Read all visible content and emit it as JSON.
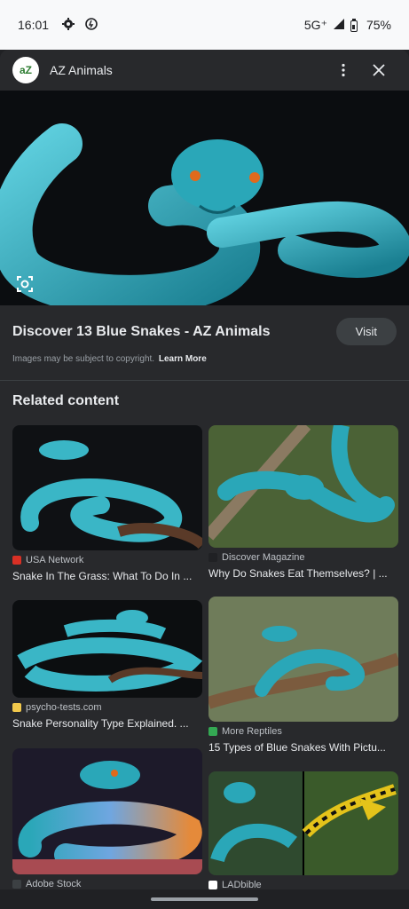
{
  "status_bar": {
    "time": "16:01",
    "network": "5G⁺",
    "battery_percent": "75%",
    "battery_level": 0.75
  },
  "header": {
    "site_name": "AZ Animals",
    "logo_text": "aZ",
    "more_icon": "more-vert-icon",
    "close_icon": "close-icon"
  },
  "preview": {
    "title": "Discover 13 Blue Snakes - AZ Animals",
    "visit_label": "Visit",
    "copyright_text": "Images may be subject to copyright.",
    "learn_more": "Learn More",
    "lens_icon": "lens-icon"
  },
  "related": {
    "heading": "Related content",
    "items": [
      {
        "source": "USA Network",
        "caption": "Snake In The Grass: What To Do In ...",
        "favicon_color": "#d93025"
      },
      {
        "source": "Discover Magazine",
        "caption": "Why Do Snakes Eat Themselves? | ...",
        "favicon_color": "#202124"
      },
      {
        "source": "psycho-tests.com",
        "caption": "Snake Personality Type Explained. ...",
        "favicon_color": "#f2c94c"
      },
      {
        "source": "More Reptiles",
        "caption": "15 Types of Blue Snakes With Pictu...",
        "favicon_color": "#34a853"
      },
      {
        "source": "Adobe Stock",
        "caption": "",
        "favicon_color": "#3c4043"
      },
      {
        "source": "LADbible",
        "caption": "",
        "favicon_color": "#ffffff"
      }
    ]
  },
  "colors": {
    "background": "#202124",
    "sheet": "#28292c",
    "snake_teal": "#2aa7b8",
    "accent_orange": "#e06a1c"
  }
}
